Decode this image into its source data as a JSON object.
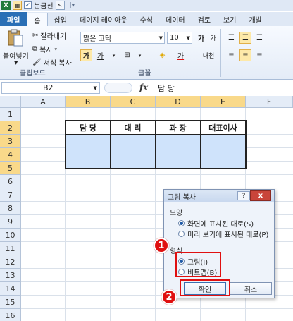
{
  "qat": {
    "gridlines_label": "눈금선"
  },
  "tabs": [
    "파일",
    "홈",
    "삽입",
    "페이지 레이아웃",
    "수식",
    "데이터",
    "검토",
    "보기",
    "개발"
  ],
  "ribbon": {
    "paste_label": "붙여넣기",
    "cut_label": "잘라내기",
    "copy_label": "복사",
    "format_painter_label": "서식 복사",
    "clipboard_group": "클립보드",
    "font_name": "맑은 고딕",
    "font_size": "10",
    "font_group": "글꼴",
    "bold_label": "가",
    "underline_label": "가",
    "grow_font": "가",
    "shrink_font": "가",
    "fill_color_label": "가",
    "phonetic_label": "내천"
  },
  "formula_bar": {
    "cell_ref": "B2",
    "fx": "fx",
    "value": "담 당"
  },
  "columns": [
    "A",
    "B",
    "C",
    "D",
    "E",
    "F"
  ],
  "rows": [
    "1",
    "2",
    "3",
    "4",
    "5",
    "6",
    "7",
    "8",
    "9",
    "10",
    "11",
    "12",
    "13",
    "14",
    "15",
    "16"
  ],
  "table": {
    "headers": [
      "담 당",
      "대 리",
      "과 장",
      "대표이사"
    ]
  },
  "dialog": {
    "title": "그림 복사",
    "close": "x",
    "help": "?",
    "appearance_label": "모양",
    "appearance_options": [
      "화면에 표시된 대로(S)",
      "미리 보기에 표시된 대로(P)"
    ],
    "format_label": "형식",
    "format_options": [
      "그림(I)",
      "비트맵(B)"
    ],
    "ok_label": "확인",
    "cancel_label": "취소"
  },
  "markers": [
    "1",
    "2"
  ],
  "colors": {
    "accent": "#2a6fb6",
    "highlight": "#f9d98a",
    "callout": "#e01010",
    "table_fill": "#cfe3fb"
  }
}
